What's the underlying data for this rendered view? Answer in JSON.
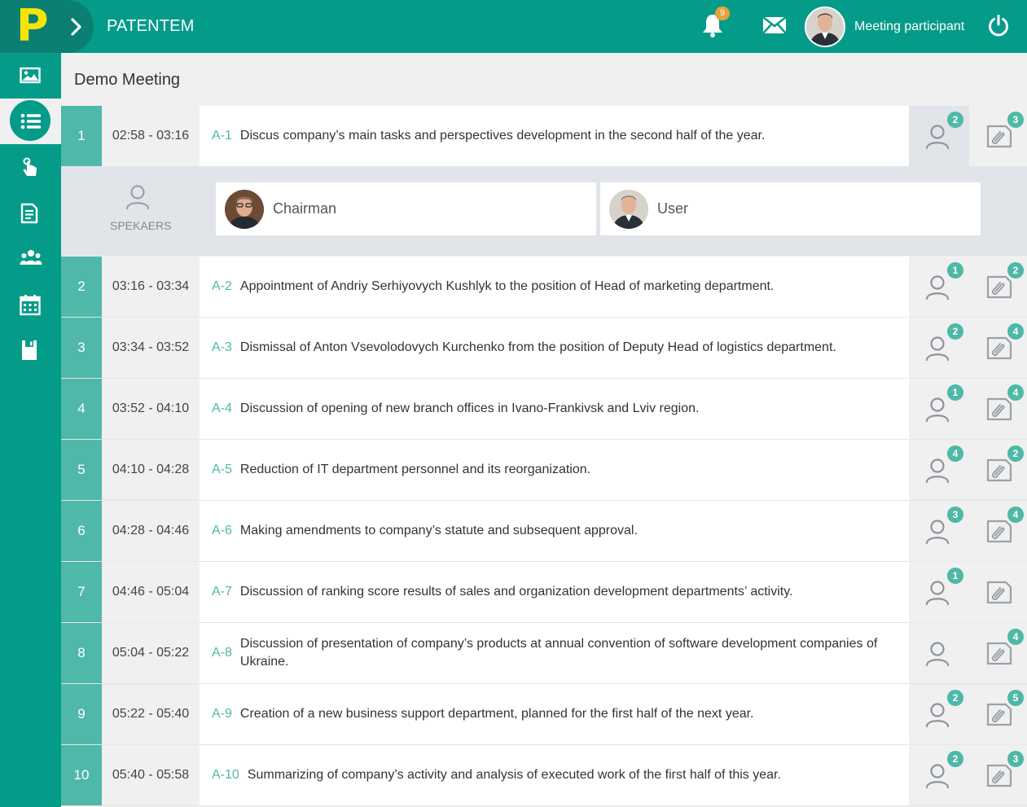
{
  "header": {
    "logo_letter": "P",
    "app_title": "PATENTEM",
    "notifications_count": "9",
    "user_name": "Meeting participant"
  },
  "sidebar": {
    "items": [
      {
        "icon": "image-icon",
        "active": false
      },
      {
        "icon": "agenda-list-icon",
        "active": true
      },
      {
        "icon": "touch-vote-icon",
        "active": false
      },
      {
        "icon": "document-icon",
        "active": false
      },
      {
        "icon": "participants-icon",
        "active": false
      },
      {
        "icon": "calendar-icon",
        "active": false
      },
      {
        "icon": "save-icon",
        "active": false
      }
    ]
  },
  "meeting": {
    "title": "Demo Meeting"
  },
  "speakers_panel": {
    "label": "SPEKAERS",
    "speakers": [
      {
        "name": "Chairman"
      },
      {
        "name": "User"
      }
    ]
  },
  "agenda": [
    {
      "num": "1",
      "time": "02:58 - 03:16",
      "code": "A-1",
      "text": "Discus company’s main tasks and perspectives development in the second half of the year.",
      "speakers": "2",
      "docs": "3"
    },
    {
      "num": "2",
      "time": "03:16 - 03:34",
      "code": "A-2",
      "text": "Appointment of Andriy Serhiyovych Kushlyk to the position of Head of marketing department.",
      "speakers": "1",
      "docs": "2"
    },
    {
      "num": "3",
      "time": "03:34 - 03:52",
      "code": "A-3",
      "text": "Dismissal of Anton Vsevolodovych Kurchenko from the position of Deputy Head of logistics department.",
      "speakers": "2",
      "docs": "4"
    },
    {
      "num": "4",
      "time": "03:52 - 04:10",
      "code": "A-4",
      "text": "Discussion of opening of new branch offices in Ivano-Frankivsk and Lviv region.",
      "speakers": "1",
      "docs": "4"
    },
    {
      "num": "5",
      "time": "04:10 - 04:28",
      "code": "A-5",
      "text": "Reduction of IT department personnel and its reorganization.",
      "speakers": "4",
      "docs": "2"
    },
    {
      "num": "6",
      "time": "04:28 - 04:46",
      "code": "A-6",
      "text": "Making amendments to company’s statute and subsequent approval.",
      "speakers": "3",
      "docs": "4"
    },
    {
      "num": "7",
      "time": "04:46 - 05:04",
      "code": "A-7",
      "text": "Discussion of ranking score results of sales and organization development departments’ activity.",
      "speakers": "1",
      "docs": ""
    },
    {
      "num": "8",
      "time": "05:04 - 05:22",
      "code": "A-8",
      "text": "Discussion of presentation of company’s products at annual convention of software development companies of Ukraine.",
      "speakers": "",
      "docs": "4"
    },
    {
      "num": "9",
      "time": "05:22 - 05:40",
      "code": "A-9",
      "text": "Creation of a new business support department, planned for the first half of the next year.",
      "speakers": "2",
      "docs": "5"
    },
    {
      "num": "10",
      "time": "05:40 - 05:58",
      "code": "A-10",
      "text": "Summarizing of company’s activity and analysis of executed work of the first half of this year.",
      "speakers": "2",
      "docs": "3"
    }
  ]
}
